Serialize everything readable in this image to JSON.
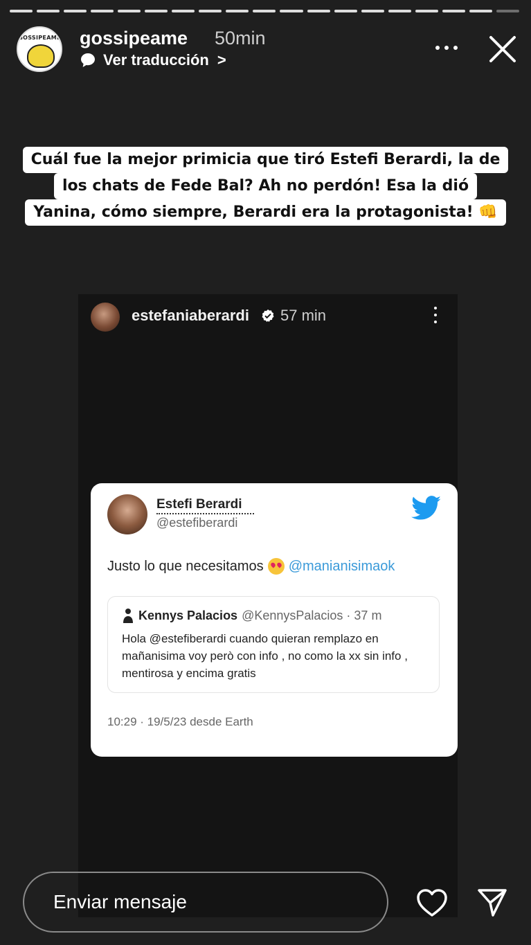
{
  "story": {
    "progress_segments": 19,
    "active_segment_index": 18,
    "account": {
      "username": "gossipeame",
      "time": "50min",
      "logo_text": "GOSSIPEAME"
    },
    "translate_label": "Ver traducción",
    "translate_chevron": ">",
    "caption_lines": [
      "Cuál fue la mejor primicia que tiró Estefi Berardi, la de",
      "los chats de Fede Bal? Ah no perdón! Esa la dió",
      "Yanina, cómo siempre, Berardi era la protagonista! 👊"
    ],
    "reply_placeholder": "Enviar mensaje"
  },
  "shared_post": {
    "username": "estefaniaberardi",
    "time": "57 min"
  },
  "tweet": {
    "name": "Estefi Berardi",
    "handle": "@estefiberardi",
    "text": "Justo lo que necesitamos",
    "mention": "@manianisimaok",
    "quote": {
      "name": "Kennys Palacios",
      "meta": "@KennysPalacios · 37 m",
      "body": "Hola @estefiberardi  cuando quieran remplazo en mañanisima voy però con info ,  no como la xx sin info , mentirosa y encima gratis"
    },
    "footer": "10:29 · 19/5/23 desde Earth"
  },
  "colors": {
    "background": "#1f1f1f",
    "mention": "#3a9ad9",
    "twitter_bird": "#1d9bf0",
    "verified": "#ffffff"
  },
  "icons": [
    "speech-bubble-icon",
    "more-icon",
    "close-icon",
    "verified-icon",
    "twitter-bird-icon",
    "heart-icon",
    "send-icon"
  ]
}
